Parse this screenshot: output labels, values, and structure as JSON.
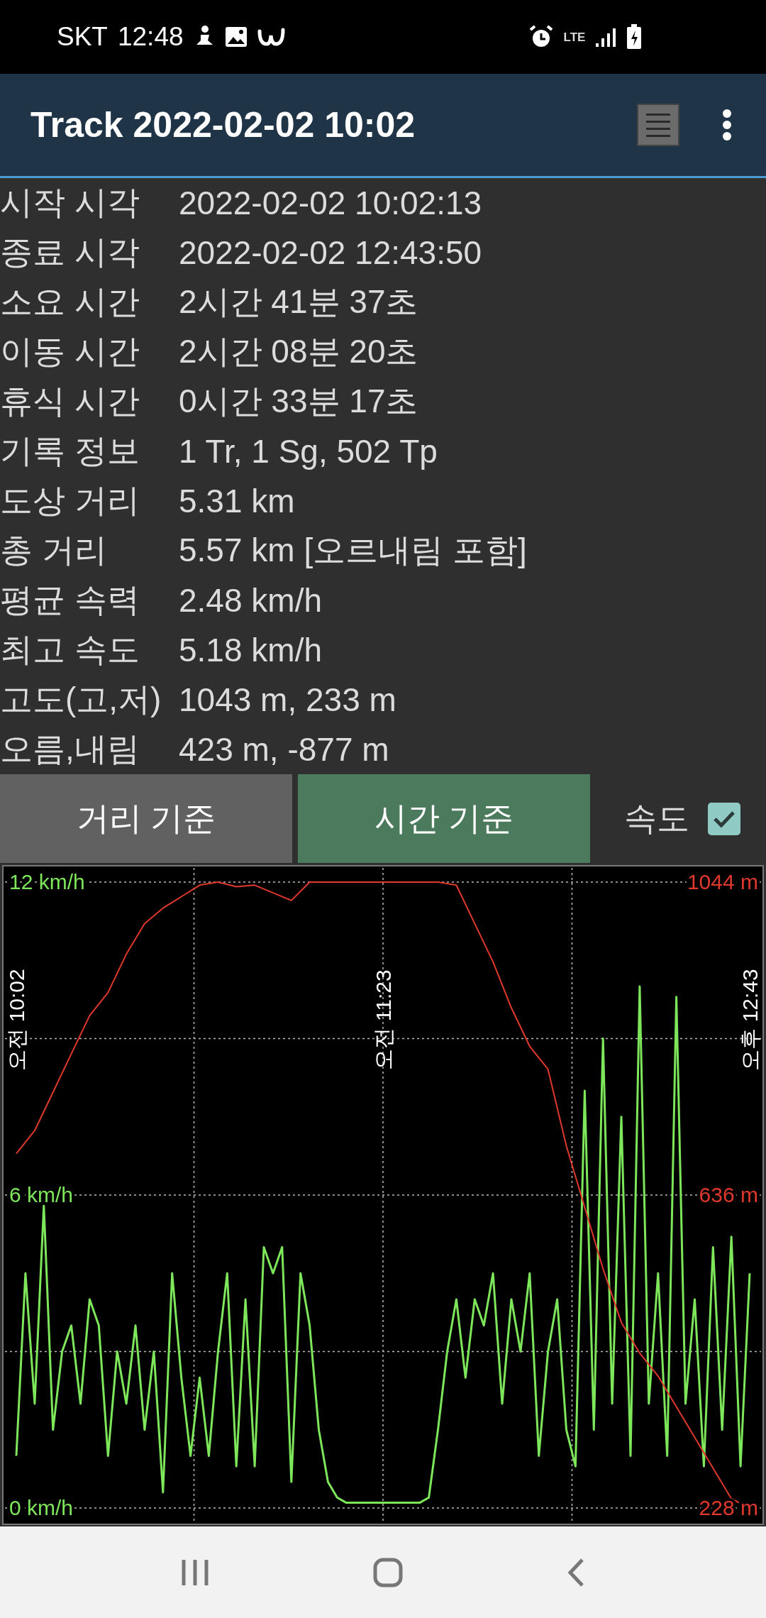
{
  "status_bar": {
    "carrier": "SKT",
    "time": "12:48",
    "network": "LTE"
  },
  "app_bar": {
    "title": "Track 2022-02-02 10:02"
  },
  "details": [
    {
      "label": "시작 시각",
      "value": "2022-02-02 10:02:13"
    },
    {
      "label": "종료 시각",
      "value": "2022-02-02 12:43:50"
    },
    {
      "label": "소요 시간",
      "value": "2시간 41분 37초"
    },
    {
      "label": "이동 시간",
      "value": "2시간 08분 20초"
    },
    {
      "label": "휴식 시간",
      "value": "0시간 33분 17초"
    },
    {
      "label": "기록 정보",
      "value": "1 Tr, 1 Sg, 502 Tp"
    },
    {
      "label": "도상 거리",
      "value": "5.31 km"
    },
    {
      "label": "총 거리",
      "value": "5.57 km [오르내림 포함]"
    },
    {
      "label": "평균 속력",
      "value": "2.48 km/h"
    },
    {
      "label": "최고 속도",
      "value": "5.18 km/h"
    },
    {
      "label": "고도(고,저)",
      "value": "1043 m, 233 m"
    },
    {
      "label": "오름,내림",
      "value": "423 m, -877 m"
    }
  ],
  "view_buttons": [
    {
      "label": "거리 기준",
      "selected": false
    },
    {
      "label": "시간 기준",
      "selected": true
    }
  ],
  "speed_toggle": {
    "label": "속도",
    "checked": true
  },
  "speed_chart": {
    "chart_data": {
      "type": "line",
      "categories": [
        "오전 10:02",
        null,
        null,
        null,
        null,
        null,
        null,
        null,
        null,
        null,
        null,
        null,
        null,
        null,
        null,
        null,
        null,
        null,
        null,
        null,
        null,
        null,
        null,
        null,
        null,
        null,
        null,
        null,
        null,
        null,
        null,
        null,
        null,
        null,
        null,
        null,
        null,
        null,
        null,
        null,
        "오전 11:23",
        null,
        null,
        null,
        null,
        null,
        null,
        null,
        null,
        null,
        null,
        null,
        null,
        null,
        null,
        null,
        null,
        null,
        null,
        null,
        null,
        null,
        null,
        null,
        null,
        null,
        null,
        null,
        null,
        null,
        null,
        null,
        null,
        null,
        null,
        null,
        null,
        null,
        null,
        null,
        "오후 12:43"
      ],
      "series": [
        {
          "color": "#7de65a",
          "values": [
            1,
            4.5,
            2,
            5.8,
            1.5,
            3,
            3.5,
            2,
            4,
            3.5,
            1,
            3,
            2,
            3.5,
            1.5,
            3,
            0.3,
            4.5,
            2.5,
            1,
            2.5,
            1,
            3,
            4.5,
            0.8,
            4,
            0.8,
            5,
            4.5,
            5,
            0.5,
            4.5,
            3.5,
            1.5,
            0.5,
            0.2,
            0.1,
            0.1,
            0.1,
            0.1,
            0.1,
            0.1,
            0.1,
            0.1,
            0.1,
            0.2,
            1.5,
            3,
            4,
            2.5,
            4,
            3.5,
            4.5,
            2,
            4,
            3,
            4.5,
            1,
            3,
            4,
            1.5,
            0.8,
            8,
            1.5,
            9,
            2,
            7.5,
            1,
            10,
            2,
            4.5,
            1,
            9.8,
            2,
            4,
            0.8,
            5,
            1.5,
            5.2,
            0.8,
            4.5
          ]
        }
      ],
      "ylim": [
        0,
        12
      ],
      "yticks": [
        {
          "value": 0,
          "label": "0 km/h"
        },
        {
          "value": 6,
          "label": "6 km/h"
        },
        {
          "value": 12,
          "label": "12 km/h"
        }
      ]
    }
  },
  "elevation_chart": {
    "chart_data": {
      "type": "line",
      "categories": [
        null,
        null,
        null,
        null,
        null,
        null,
        null,
        null,
        null,
        null,
        null,
        null,
        null,
        null,
        null,
        null,
        null,
        null,
        null,
        null,
        null,
        null,
        null,
        null,
        null,
        null,
        null,
        null,
        null,
        null,
        null,
        null,
        null,
        null,
        null,
        null,
        null,
        null,
        null,
        null,
        null
      ],
      "series": [
        {
          "color": "#e0382c",
          "values": [
            690,
            720,
            770,
            820,
            870,
            900,
            950,
            990,
            1010,
            1025,
            1040,
            1044,
            1038,
            1040,
            1030,
            1020,
            1044,
            1044,
            1044,
            1044,
            1044,
            1044,
            1044,
            1044,
            1040,
            990,
            940,
            880,
            830,
            800,
            700,
            620,
            540,
            470,
            430,
            400,
            360,
            320,
            280,
            240,
            228
          ]
        }
      ],
      "ylim": [
        205.8,
        1066.2
      ],
      "yticks": [
        {
          "value": 228,
          "label": "228 m"
        },
        {
          "value": 636,
          "label": "636 m"
        },
        {
          "value": 1044,
          "label": "1044 m"
        }
      ]
    }
  }
}
